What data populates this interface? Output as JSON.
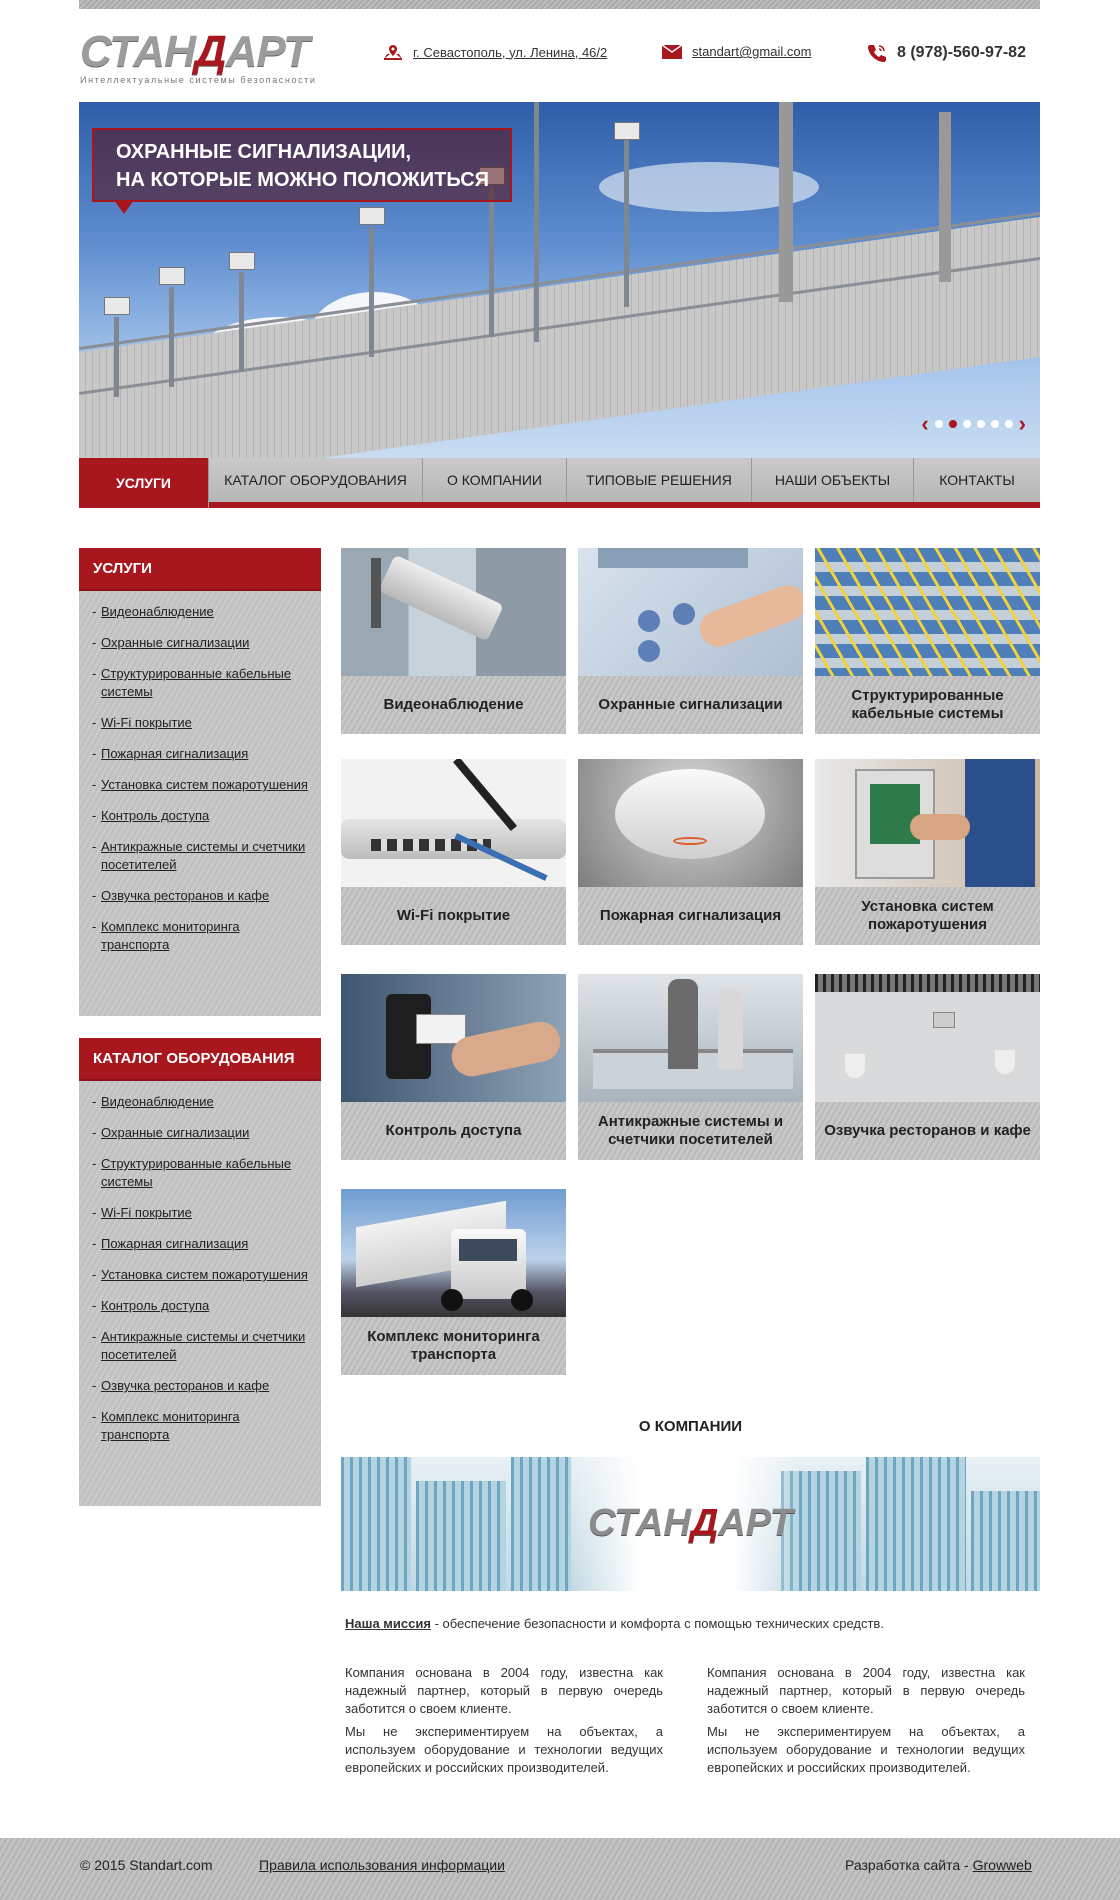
{
  "header": {
    "logo_text": "СТАНДАРТ",
    "logo_tagline": "Интеллектуальные системы безопасности",
    "address": "г. Севастополь, ул. Ленина, 46/2",
    "email": "standart@gmail.com",
    "phone": "8 (978)-560-97-82"
  },
  "hero": {
    "line1": "ОХРАННЫЕ СИГНАЛИЗАЦИИ,",
    "line2": "НА КОТОРЫЕ МОЖНО ПОЛОЖИТЬСЯ",
    "slides_total": 6,
    "active_slide": 2
  },
  "nav": [
    "УСЛУГИ",
    "КАТАЛОГ ОБОРУДОВАНИЯ",
    "О КОМПАНИИ",
    "ТИПОВЫЕ РЕШЕНИЯ",
    "НАШИ ОБЪЕКТЫ",
    "КОНТАКТЫ"
  ],
  "sidebar_services": {
    "title": "УСЛУГИ",
    "items": [
      "Видеонаблюдение",
      "Охранные сигнализации",
      "Структурированные кабельные системы",
      "Wi-Fi покрытие",
      "Пожарная сигнализация",
      "Установка систем пожаротушения",
      "Контроль доступа",
      "Антикражные системы и счетчики посетителей",
      "Озвучка ресторанов и кафе",
      "Комплекс мониторинга транспорта"
    ]
  },
  "sidebar_catalog": {
    "title": "КАТАЛОГ ОБОРУДОВАНИЯ",
    "items": [
      "Видеонаблюдение",
      "Охранные сигнализации",
      "Структурированные кабельные системы",
      "Wi-Fi покрытие",
      "Пожарная сигнализация",
      "Установка систем пожаротушения",
      "Контроль доступа",
      "Антикражные системы и счетчики посетителей",
      "Озвучка ресторанов и кафе",
      "Комплекс мониторинга транспорта"
    ]
  },
  "tiles": [
    "Видеонаблюдение",
    "Охранные сигнализации",
    "Структурированные кабельные системы",
    "Wi-Fi покрытие",
    "Пожарная сигнализация",
    "Установка систем пожаротушения",
    "Контроль доступа",
    "Антикражные системы и счетчики посетителей",
    "Озвучка ресторанов и кафе",
    "Комплекс мониторинга транспорта"
  ],
  "about": {
    "title": "О КОМПАНИИ",
    "banner_logo": "СТАНДАРТ",
    "mission_label": "Наша миссия",
    "mission_text": " - обеспечение безопасности и комфорта с помощью технических средств.",
    "col1_p1": "Компания основана в 2004 году, известна как надежный партнер, который в первую очередь заботится о своем клиенте.",
    "col1_p2": "Мы не экспериментируем на объектах, а используем оборудование и технологии ведущих европейских и российских производителей.",
    "col2_p1": "Компания основана в 2004 году, известна как надежный партнер, который в первую очередь заботится о своем клиенте.",
    "col2_p2": "Мы не экспериментируем на объектах, а используем оборудование и технологии ведущих европейских и российских производителей."
  },
  "footer": {
    "copyright": "© 2015 Standart.com",
    "rules_link": "Правила использования информации",
    "dev_label": "Разработка сайта - ",
    "dev_link": "Growweb"
  },
  "colors": {
    "accent": "#a8171d",
    "metal": "#c2c2c2"
  },
  "icons": [
    "map-pin-icon",
    "envelope-icon",
    "phone-icon",
    "chevron-left-icon",
    "chevron-right-icon"
  ]
}
